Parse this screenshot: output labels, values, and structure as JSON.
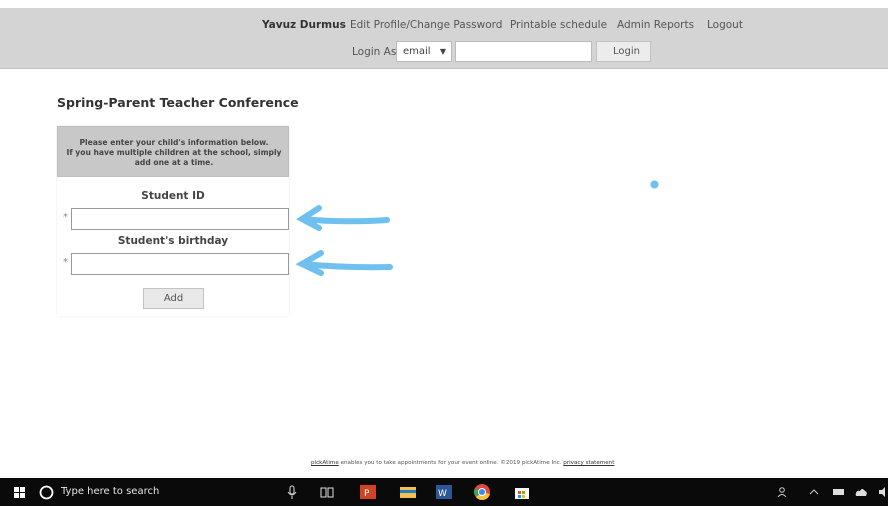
{
  "nav": {
    "user": "Yavuz Durmus",
    "items": [
      "Edit Profile/Change Password",
      "Printable schedule",
      "Admin Reports",
      "Logout"
    ]
  },
  "login": {
    "label": "Login As:",
    "select_value": "email",
    "button": "Login"
  },
  "page": {
    "title": "Spring-Parent Teacher Conference",
    "instructions": [
      "Please enter your child's information below.",
      "If you have multiple children at the school, simply",
      "add one at a time."
    ],
    "fields": [
      {
        "label": "Student ID",
        "required": "*"
      },
      {
        "label": "Student's birthday",
        "required": "*"
      }
    ],
    "add_button": "Add"
  },
  "footer": {
    "link1": "pickAtime",
    "text": " enables you to take appointments for your event online. ©2019 pickAtime Inc. ",
    "link2": "privacy statement"
  },
  "taskbar": {
    "search_placeholder": "Type here to search",
    "icons": [
      "windows-start-icon",
      "cortana-circle-icon",
      "microphone-icon",
      "task-view-icon",
      "powerpoint-icon",
      "file-explorer-icon",
      "word-icon",
      "chrome-icon",
      "store-icon"
    ],
    "tray_icons": [
      "people-icon",
      "chevron-up-icon",
      "battery-icon",
      "cloud-icon",
      "speaker-icon"
    ]
  },
  "colors": {
    "header_bg": "#d4d4d4",
    "panel_head_bg": "#c8c8c8",
    "annotation_blue": "#6ec1ee",
    "taskbar_bg": "#0a0a0a"
  }
}
